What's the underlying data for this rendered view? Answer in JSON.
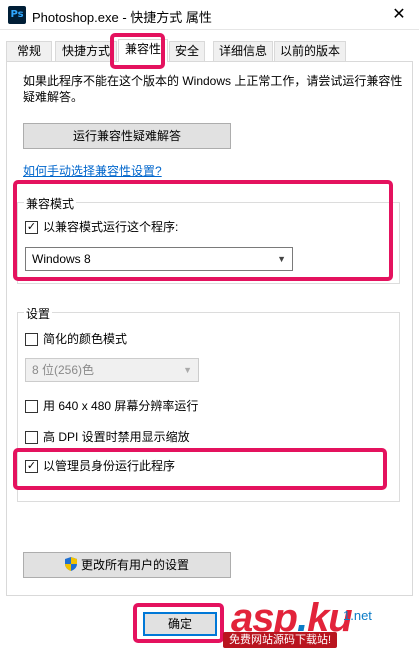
{
  "window": {
    "icon_text": "Ps",
    "title": "Photoshop.exe - 快捷方式 属性",
    "close_glyph": "✕"
  },
  "tabs": [
    {
      "label": "常规"
    },
    {
      "label": "快捷方式"
    },
    {
      "label": "兼容性",
      "active": true
    },
    {
      "label": "安全"
    },
    {
      "label": "详细信息"
    },
    {
      "label": "以前的版本"
    }
  ],
  "compat": {
    "description": "如果此程序不能在这个版本的 Windows 上正常工作，请尝试运行兼容性疑难解答。",
    "troubleshoot_button": "运行兼容性疑难解答",
    "manual_link": "如何手动选择兼容性设置?",
    "mode_group": {
      "legend": "兼容模式",
      "checkbox_label": "以兼容模式运行这个程序:",
      "checked": true,
      "selected_os": "Windows 8"
    },
    "settings_group": {
      "legend": "设置",
      "reduced_color": {
        "label": "简化的颜色模式",
        "checked": false
      },
      "color_depth": "8 位(256)色",
      "run_640": {
        "label": "用 640 x 480 屏幕分辨率运行",
        "checked": false
      },
      "dpi_scaling": {
        "label": "高 DPI 设置时禁用显示缩放",
        "checked": false
      },
      "run_as_admin": {
        "label": "以管理员身份运行此程序",
        "checked": true
      }
    },
    "all_users_button": "更改所有用户的设置"
  },
  "footer": {
    "ok_button": "确定"
  },
  "watermark": {
    "brand_a": "asp",
    "brand_dot": ".",
    "brand_b": "ku",
    "small": "1.net",
    "tagline": "免费网站源码下载站!"
  },
  "icons": {
    "app": "photoshop-icon",
    "close": "close-icon",
    "checkmark": "✓",
    "dropdown": "▼",
    "shield": "uac-shield-icon"
  },
  "colors": {
    "highlight": "#e4125e",
    "link": "#0066cc",
    "focus": "#0078d7"
  }
}
